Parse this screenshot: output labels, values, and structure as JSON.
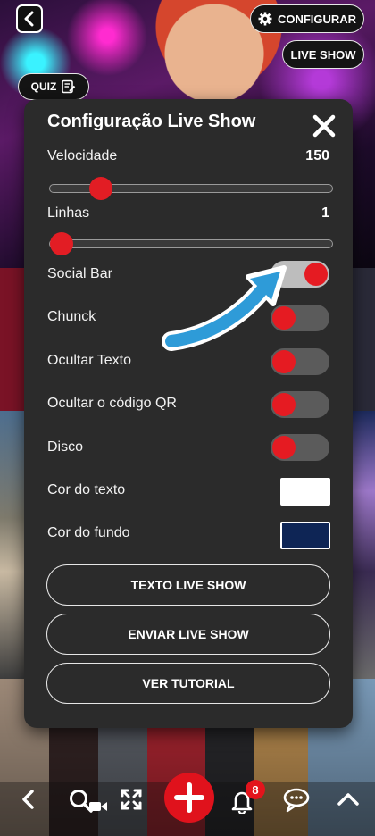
{
  "header": {
    "configurar_label": "CONFIGURAR",
    "live_show_label": "LIVE SHOW",
    "quiz_label": "QUIZ"
  },
  "modal": {
    "title": "Configuração Live Show",
    "velocidade": {
      "label": "Velocidade",
      "value": "150",
      "fraction": 0.18
    },
    "linhas": {
      "label": "Linhas",
      "value": "1",
      "fraction": 0.04
    },
    "toggles": [
      {
        "label": "Social Bar",
        "on": true
      },
      {
        "label": "Chunck",
        "on": false
      },
      {
        "label": "Ocultar Texto",
        "on": false
      },
      {
        "label": "Ocultar o código QR",
        "on": false
      },
      {
        "label": "Disco",
        "on": false
      }
    ],
    "cor_texto": {
      "label": "Cor do texto",
      "color": "#ffffff"
    },
    "cor_fundo": {
      "label": "Cor do fundo",
      "color": "#0e2555"
    },
    "buttons": {
      "texto": "TEXTO LIVE SHOW",
      "enviar": "ENVIAR LIVE SHOW",
      "tutorial": "VER TUTORIAL"
    }
  },
  "bottom_bar": {
    "notification_count": "8"
  },
  "colors": {
    "accent": "#e21d24",
    "arrow": "#2e9bd8",
    "modal_bg": "#2b2b2b"
  }
}
